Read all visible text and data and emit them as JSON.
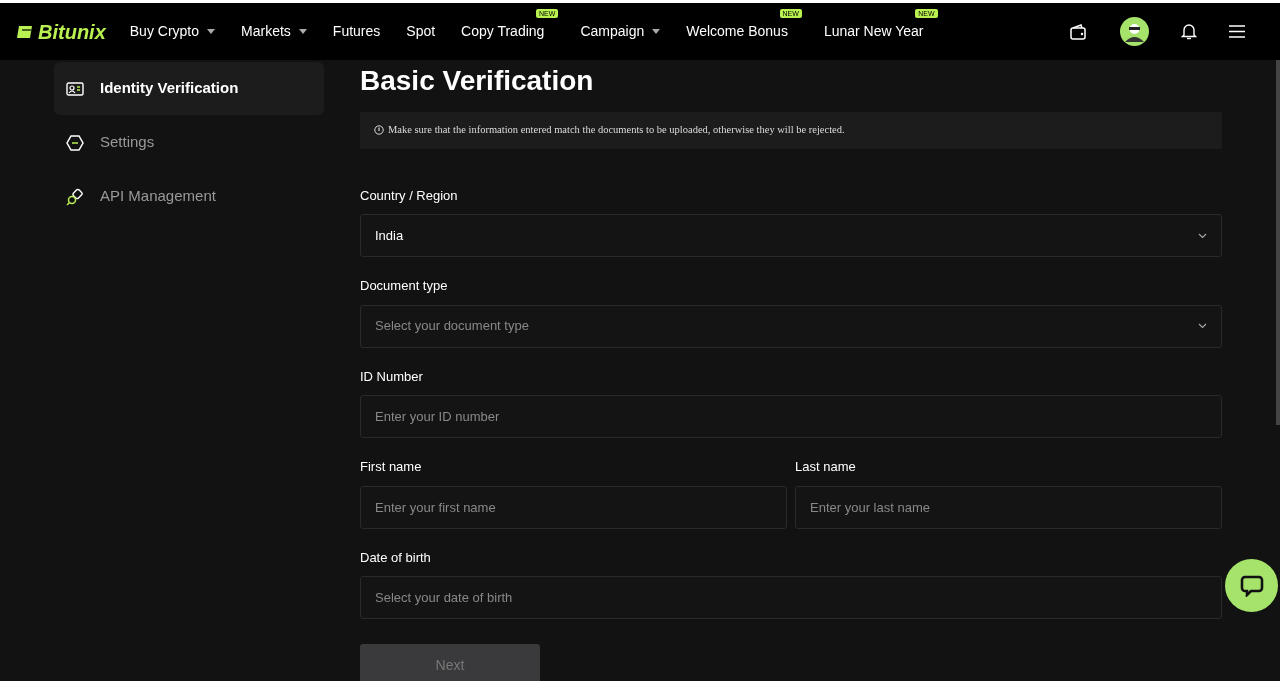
{
  "navbar": {
    "logo": "Bitunix",
    "items": [
      {
        "label": "Buy Crypto",
        "dropdown": true
      },
      {
        "label": "Markets",
        "dropdown": true
      },
      {
        "label": "Futures",
        "dropdown": false
      },
      {
        "label": "Spot",
        "dropdown": false
      },
      {
        "label": "Copy Trading",
        "dropdown": false,
        "badge": "NEW"
      },
      {
        "label": "Campaign",
        "dropdown": true
      },
      {
        "label": "Welcome Bonus",
        "dropdown": false,
        "badge": "NEW"
      },
      {
        "label": "Lunar New Year",
        "dropdown": false,
        "badge": "NEW"
      }
    ]
  },
  "sidebar": {
    "items": [
      {
        "label": "Identity Verification",
        "selected": true
      },
      {
        "label": "Settings",
        "selected": false
      },
      {
        "label": "API Management",
        "selected": false
      }
    ]
  },
  "page": {
    "title": "Basic Verification",
    "notice": "Make sure that the information entered match the documents to be uploaded, otherwise they will be rejected.",
    "rows": [
      [
        {
          "label": "Country / Region",
          "kind": "select",
          "value": "India"
        }
      ],
      [
        {
          "label": "Document type",
          "kind": "select",
          "placeholder": "Select your document type"
        }
      ],
      [
        {
          "label": "ID Number",
          "kind": "input",
          "placeholder": "Enter your ID number"
        }
      ],
      [
        {
          "label": "First name",
          "kind": "input",
          "placeholder": "Enter your first name"
        },
        {
          "label": "Last name",
          "kind": "input",
          "placeholder": "Enter your last name"
        }
      ],
      [
        {
          "label": "Date of birth",
          "kind": "input",
          "placeholder": "Select your date of birth"
        }
      ]
    ],
    "next_button": {
      "label": "Next",
      "disabled": true
    }
  }
}
